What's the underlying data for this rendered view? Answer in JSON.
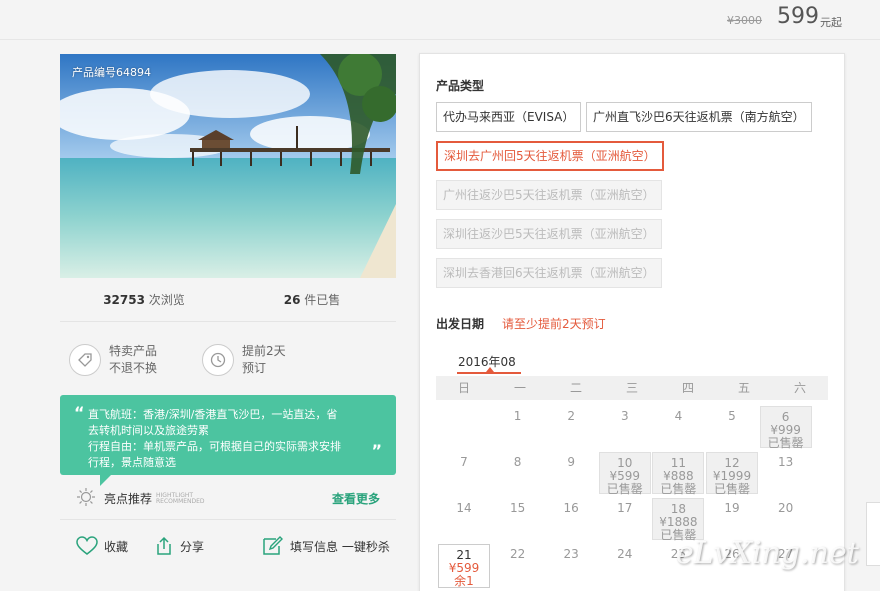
{
  "price": {
    "original": "¥3000",
    "current": "599",
    "unit": "元起"
  },
  "product": {
    "code": "产品编号64894",
    "views_num": "32753",
    "views_label": "次浏览",
    "sold_num": "26",
    "sold_label": "件已售"
  },
  "features": [
    {
      "icon": "tag-icon",
      "line1": "特卖产品",
      "line2": "不退不换"
    },
    {
      "icon": "clock-icon",
      "line1": "提前2天",
      "line2": "预订"
    }
  ],
  "highlight": {
    "open_quote": "“",
    "close_quote": "”",
    "line1": "直飞航班：香港/深圳/香港直飞沙巴，一站直达，省",
    "line2": "去转机时间以及旅途劳累",
    "line3": "行程自由：单机票产品，可根据自己的实际需求安排",
    "line4": "行程，景点随意选",
    "rec_label": "亮点推荐",
    "rec_en1": "HIGHTLIGHT",
    "rec_en2": "RECOMMENDED",
    "more": "查看更多"
  },
  "actions": {
    "fav": "收藏",
    "share": "分享",
    "fill": "填写信息 一键秒杀"
  },
  "panel": {
    "type_title": "产品类型",
    "options": [
      "代办马来西亚（EVISA）",
      "广州直飞沙巴6天往返机票（南方航空）",
      "深圳去广州回5天往返机票（亚洲航空）",
      "广州往返沙巴5天往返机票（亚洲航空）",
      "深圳往返沙巴5天往返机票（亚洲航空）",
      "深圳去香港回6天往返机票（亚洲航空）"
    ],
    "date_title": "出发日期",
    "date_hint": "请至少提前2天预订",
    "month": "2016年08"
  },
  "calendar": {
    "weekdays": [
      "日",
      "一",
      "二",
      "三",
      "四",
      "五",
      "六"
    ],
    "days": [
      {
        "d": "1"
      },
      {
        "d": "2"
      },
      {
        "d": "3"
      },
      {
        "d": "4"
      },
      {
        "d": "5"
      },
      {
        "d": "6",
        "price": "¥999",
        "status": "已售罄"
      },
      {
        "d": "7"
      },
      {
        "d": "8"
      },
      {
        "d": "9"
      },
      {
        "d": "10",
        "price": "¥599",
        "status": "已售罄"
      },
      {
        "d": "11",
        "price": "¥888",
        "status": "已售罄"
      },
      {
        "d": "12",
        "price": "¥1999",
        "status": "已售罄"
      },
      {
        "d": "13"
      },
      {
        "d": "14"
      },
      {
        "d": "15"
      },
      {
        "d": "16"
      },
      {
        "d": "17"
      },
      {
        "d": "18",
        "price": "¥1888",
        "status": "已售罄"
      },
      {
        "d": "19"
      },
      {
        "d": "20"
      },
      {
        "d": "21",
        "price": "¥599",
        "status": "余1"
      },
      {
        "d": "22"
      },
      {
        "d": "23"
      },
      {
        "d": "24"
      },
      {
        "d": "25"
      },
      {
        "d": "26"
      },
      {
        "d": "27"
      }
    ]
  },
  "watermark": "eLvXing.net"
}
